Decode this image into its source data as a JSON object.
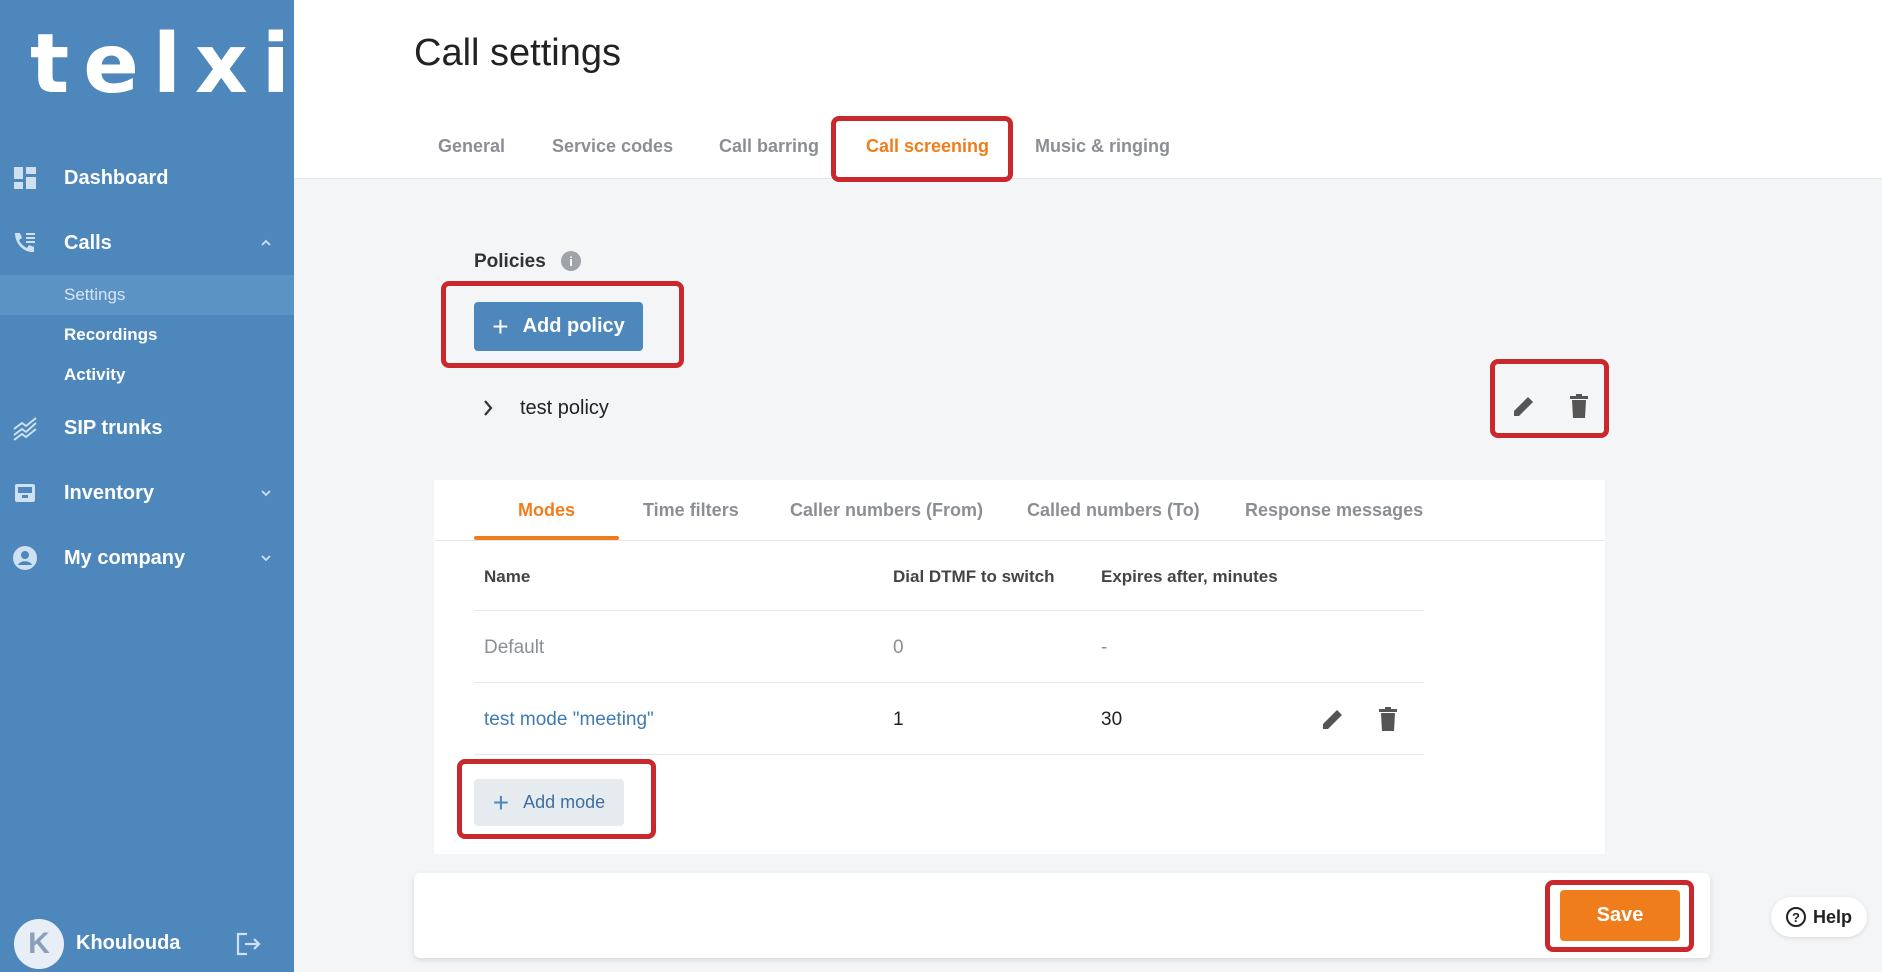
{
  "brand": {
    "logo_text": "telxi",
    "sidebar_color": "#4d87bb",
    "accent_color": "#f07d1b",
    "highlight_color": "#c9282d"
  },
  "sidebar": {
    "dashboard": "Dashboard",
    "calls": "Calls",
    "calls_sub": [
      "Settings",
      "Recordings",
      "Activity"
    ],
    "sip_trunks": "SIP trunks",
    "inventory": "Inventory",
    "my_company": "My company",
    "user": {
      "initial": "K",
      "name": "Khoulouda"
    }
  },
  "header": {
    "title": "Call settings",
    "tabs": [
      "General",
      "Service codes",
      "Call barring",
      "Call screening",
      "Music & ringing"
    ],
    "active_tab": "Call screening"
  },
  "policies": {
    "title": "Policies",
    "info_icon": "i",
    "add_button": "Add policy",
    "items": [
      {
        "name": "test policy"
      }
    ]
  },
  "modes_panel": {
    "tabs": [
      "Modes",
      "Time filters",
      "Caller numbers (From)",
      "Called numbers (To)",
      "Response messages"
    ],
    "active_tab": "Modes",
    "columns": [
      "Name",
      "Dial DTMF to switch",
      "Expires after, minutes"
    ],
    "rows": [
      {
        "name": "Default",
        "dtmf": "0",
        "expires": "-"
      },
      {
        "name": "test mode \"meeting\"",
        "dtmf": "1",
        "expires": "30"
      }
    ],
    "add_button": "Add mode"
  },
  "footer": {
    "save": "Save",
    "help": "Help",
    "help_icon": "?"
  }
}
